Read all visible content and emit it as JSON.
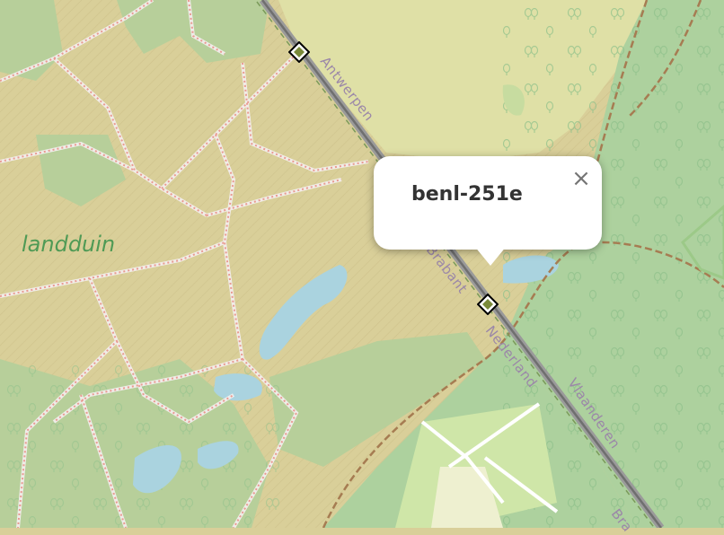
{
  "map": {
    "place_label": "landduin",
    "road_labels": [
      "Antwerpen",
      "Brabant",
      "Nederland",
      "Vlaanderen",
      "Bra"
    ]
  },
  "markers": [
    {
      "name": "marker-benl-250",
      "icon": "diamond-marker-icon"
    },
    {
      "name": "marker-benl-251e",
      "icon": "diamond-marker-icon"
    }
  ],
  "popup": {
    "title": "benl-251e",
    "close_label": "×"
  },
  "colors": {
    "heath": "#d9cf99",
    "forest": "#add19e",
    "grass": "#cdebb0",
    "water": "#aad3df",
    "boundary": "#8d8d8d",
    "path": "#fa8072"
  }
}
